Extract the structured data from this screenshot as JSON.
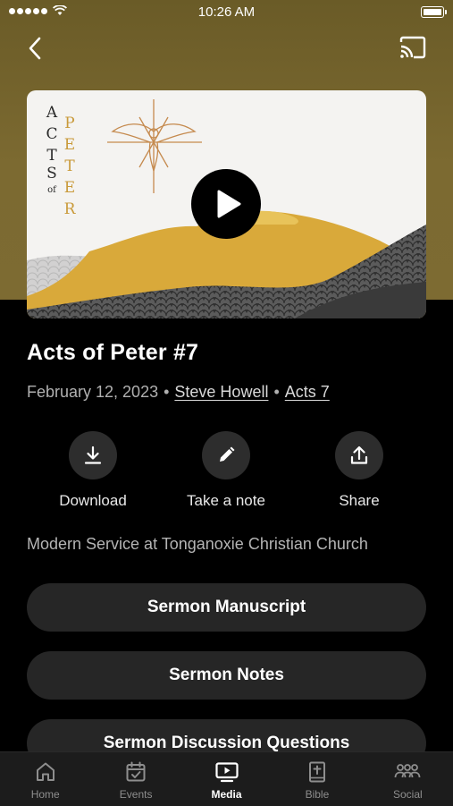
{
  "status_bar": {
    "time": "10:26 AM"
  },
  "artwork": {
    "title_left": [
      "A",
      "C",
      "T",
      "S"
    ],
    "title_of": "of",
    "title_right": [
      "P",
      "E",
      "T",
      "E",
      "R"
    ]
  },
  "sermon": {
    "title": "Acts of Peter #7",
    "date": "February 12, 2023",
    "speaker": "Steve Howell",
    "passage": "Acts 7",
    "service": "Modern Service at Tonganoxie Christian Church"
  },
  "actions": [
    {
      "label": "Download",
      "icon": "download-icon"
    },
    {
      "label": "Take a note",
      "icon": "pencil-icon"
    },
    {
      "label": "Share",
      "icon": "share-icon"
    }
  ],
  "buttons": [
    {
      "label": "Sermon Manuscript"
    },
    {
      "label": "Sermon Notes"
    },
    {
      "label": "Sermon Discussion Questions"
    }
  ],
  "tabs": [
    {
      "label": "Home",
      "icon": "home-icon"
    },
    {
      "label": "Events",
      "icon": "calendar-icon"
    },
    {
      "label": "Media",
      "icon": "media-icon"
    },
    {
      "label": "Bible",
      "icon": "bible-icon"
    },
    {
      "label": "Social",
      "icon": "people-icon"
    }
  ],
  "active_tab": "Media",
  "colors": {
    "header_gold": "#7c6a31",
    "background": "#000000",
    "pill": "#262626",
    "accent_gold": "#d9a93a"
  }
}
